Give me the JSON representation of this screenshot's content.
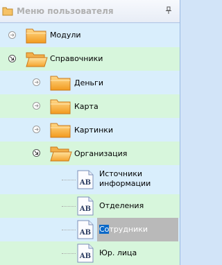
{
  "panel": {
    "title": "Меню пользователя"
  },
  "tree": {
    "modules": "Модули",
    "references": "Справочники",
    "money": "Деньги",
    "map": "Карта",
    "pictures": "Картинки",
    "organization": "Организация",
    "info_sources_line1": "Источники",
    "info_sources_line2": "информации",
    "departments": "Отделения",
    "employees_highlight": "Со",
    "employees_rest": "трудники",
    "legal_entities": "Юр. лица"
  },
  "icons": {
    "doc_badge": "AB",
    "expander_collapsed": "arrow-right",
    "expander_expanded": "arrow-down-right"
  },
  "colors": {
    "row_blue": "#d9eefc",
    "row_green": "#d7f6dc",
    "selection": "#b9b9b9",
    "text_highlight": "#0a68c8"
  }
}
